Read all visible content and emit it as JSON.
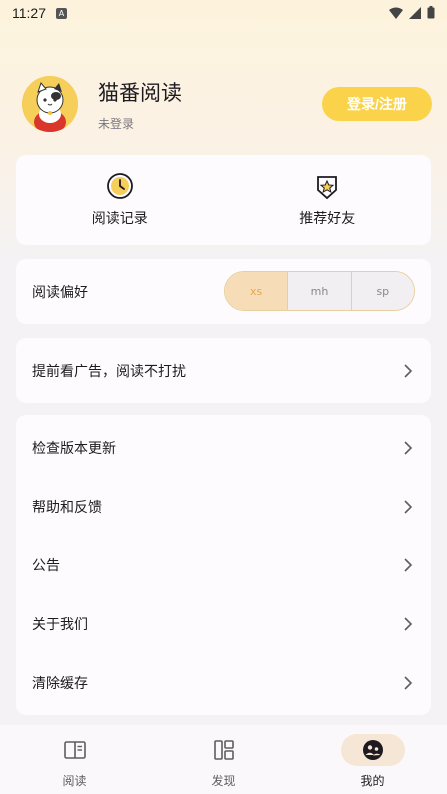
{
  "status_bar": {
    "time": "11:27",
    "notification_glyph": "A"
  },
  "profile": {
    "app_name": "猫番阅读",
    "login_status": "未登录",
    "login_button": "登录/注册"
  },
  "quick_actions": [
    {
      "label": "阅读记录",
      "icon": "clock-icon"
    },
    {
      "label": "推荐好友",
      "icon": "star-shield-icon"
    }
  ],
  "reading_preference": {
    "label": "阅读偏好",
    "options": [
      "xs",
      "mh",
      "sp"
    ],
    "selected": "xs",
    "accent_color": "#e6a84b"
  },
  "ad_row": {
    "label": "提前看广告，阅读不打扰"
  },
  "settings_list": [
    {
      "label": "检查版本更新"
    },
    {
      "label": "帮助和反馈"
    },
    {
      "label": "公告"
    },
    {
      "label": "关于我们"
    },
    {
      "label": "清除缓存"
    }
  ],
  "bottom_nav": [
    {
      "label": "阅读",
      "icon": "book-icon",
      "active": false
    },
    {
      "label": "发现",
      "icon": "discover-icon",
      "active": false
    },
    {
      "label": "我的",
      "icon": "profile-icon",
      "active": true
    }
  ],
  "colors": {
    "login_button": "#fbd34b",
    "card_bg": "#fdfbfd",
    "active_nav_bg": "#f5e6d6"
  }
}
